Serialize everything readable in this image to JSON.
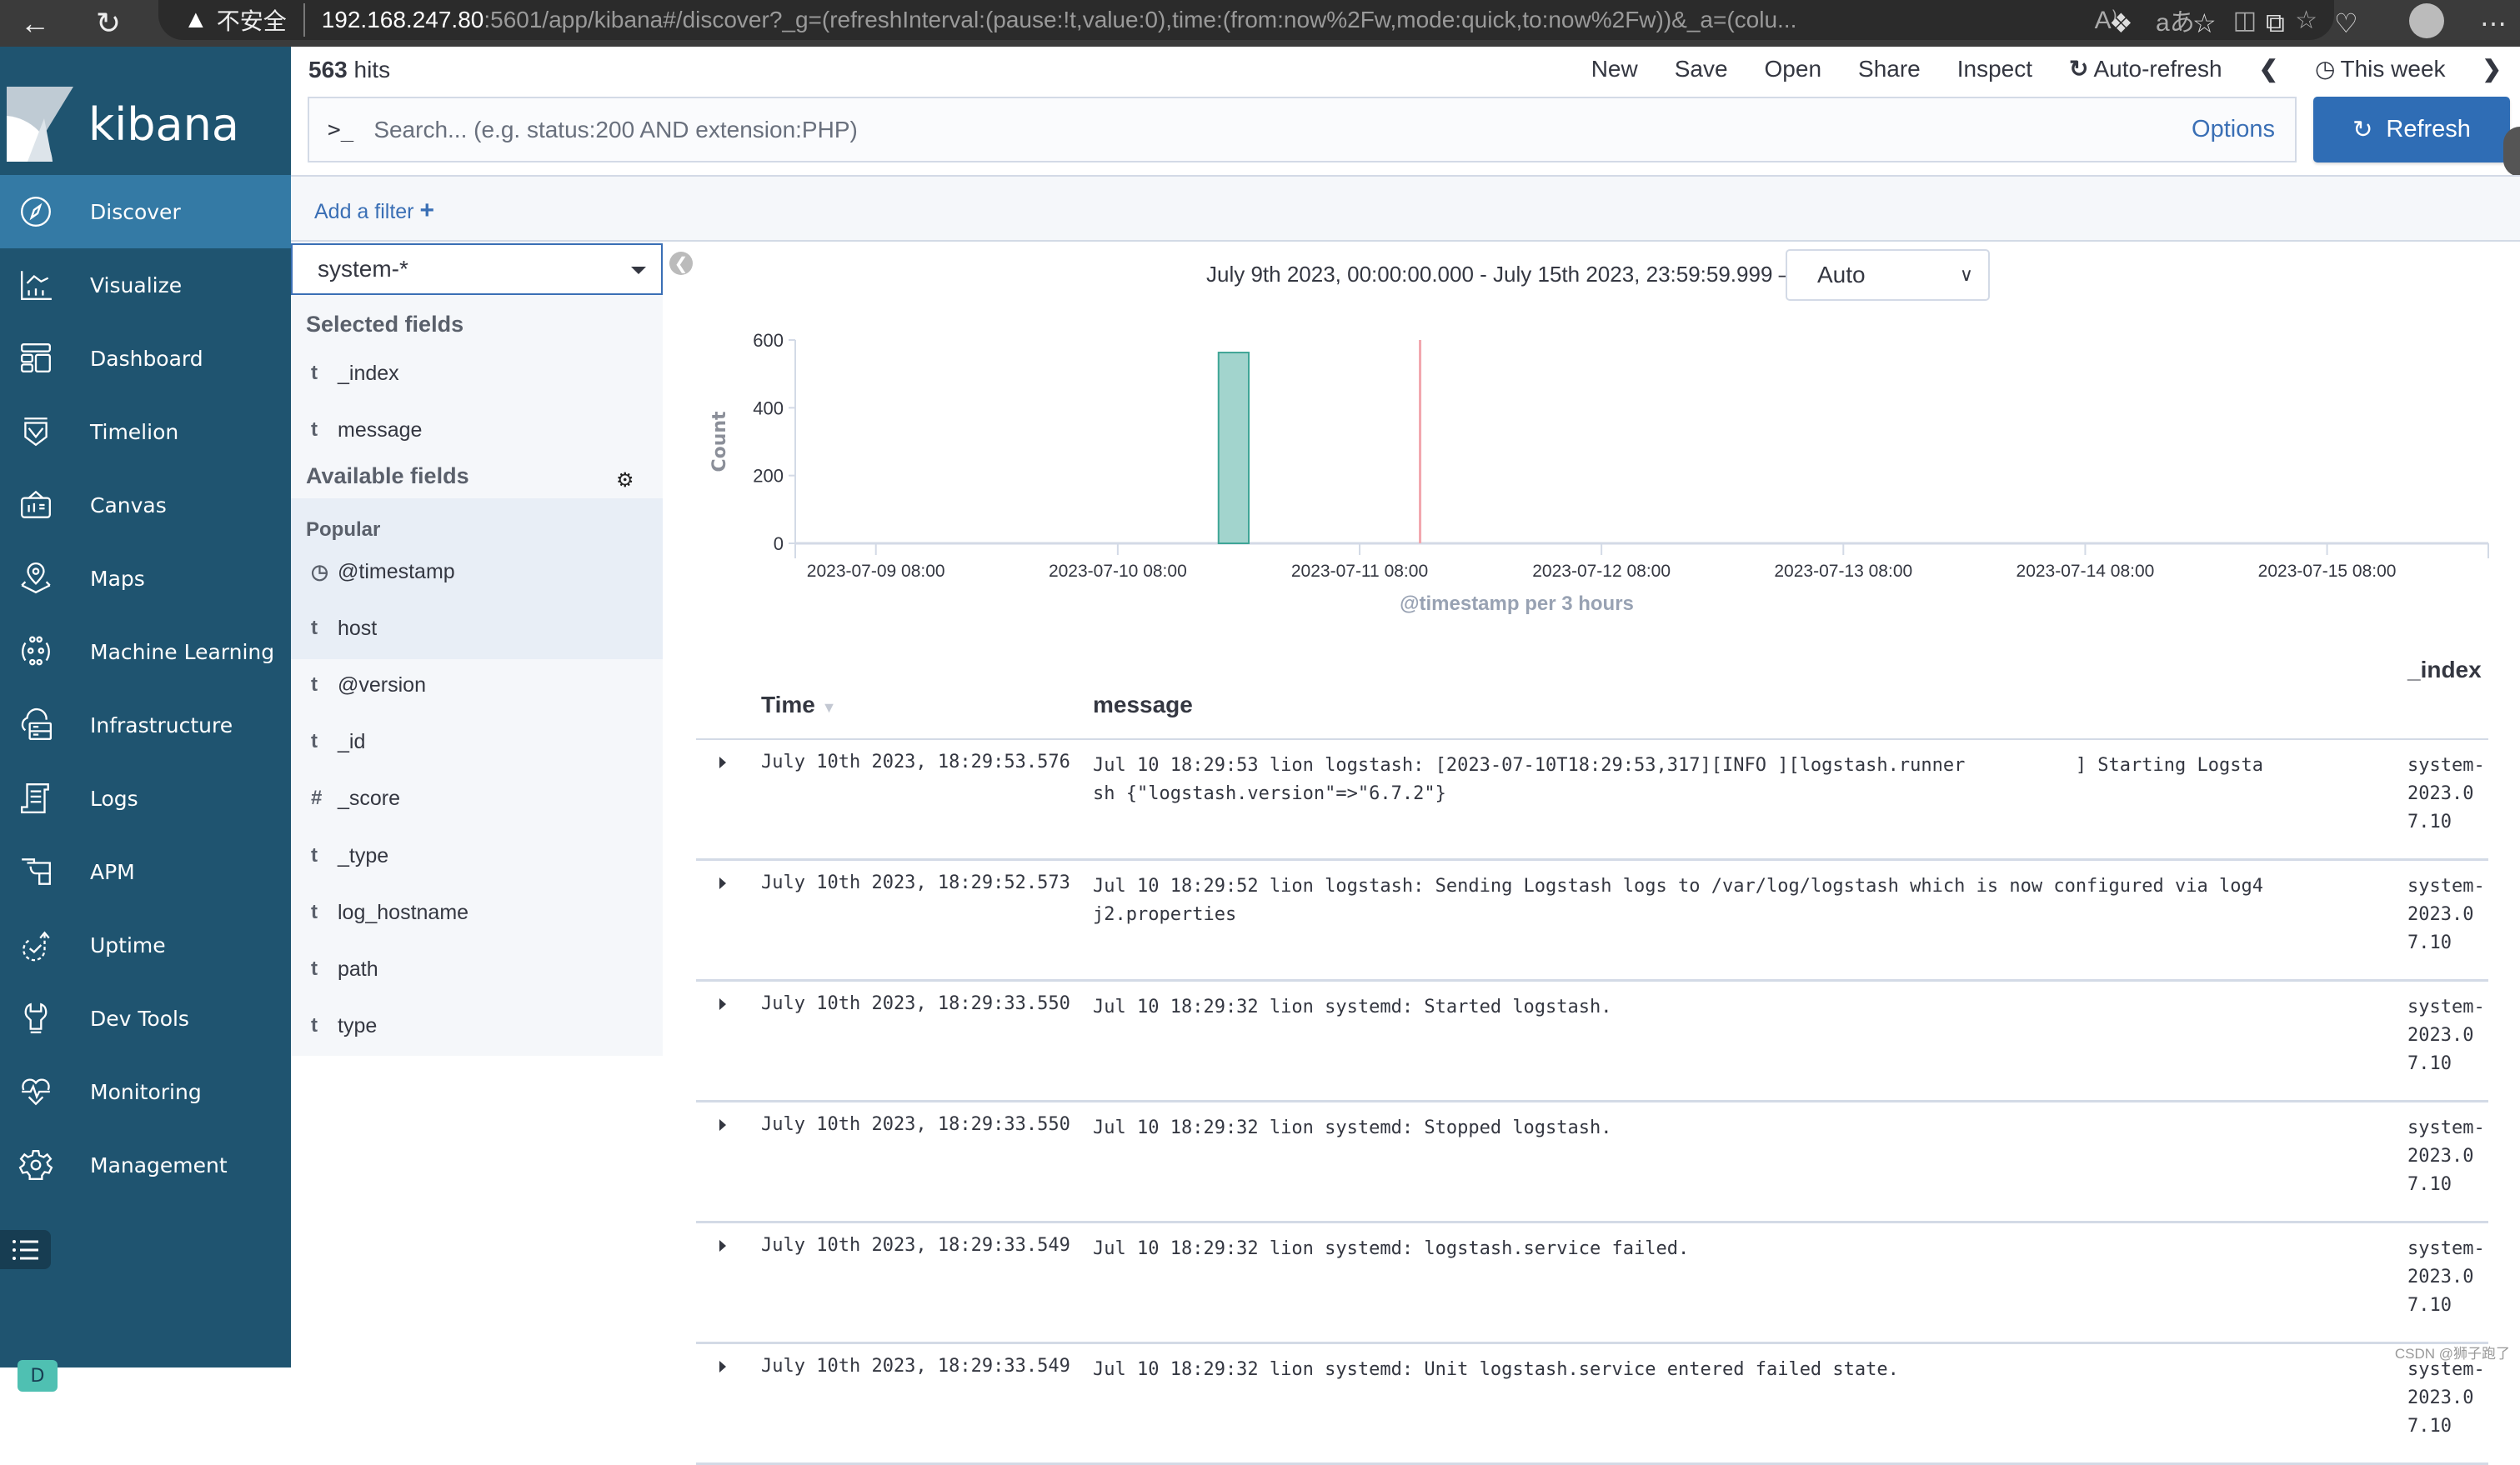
{
  "browser": {
    "warning_label": "不安全",
    "url_host": "192.168.247.80",
    "url_rest": ":5601/app/kibana#/discover?_g=(refreshInterval:(pause:!t,value:0),time:(from:now%2Fw,mode:quick,to:now%2Fw))&_a=(colu..."
  },
  "app": {
    "name": "kibana"
  },
  "sidebar": {
    "items": [
      {
        "label": "Discover",
        "icon": "compass-icon",
        "active": true
      },
      {
        "label": "Visualize",
        "icon": "visualize-icon"
      },
      {
        "label": "Dashboard",
        "icon": "dashboard-icon"
      },
      {
        "label": "Timelion",
        "icon": "timelion-icon"
      },
      {
        "label": "Canvas",
        "icon": "canvas-icon"
      },
      {
        "label": "Maps",
        "icon": "map-pin-icon"
      },
      {
        "label": "Machine Learning",
        "icon": "machine-learning-icon"
      },
      {
        "label": "Infrastructure",
        "icon": "cloud-server-icon"
      },
      {
        "label": "Logs",
        "icon": "logs-icon"
      },
      {
        "label": "APM",
        "icon": "apm-icon"
      },
      {
        "label": "Uptime",
        "icon": "uptime-icon"
      },
      {
        "label": "Dev Tools",
        "icon": "wrench-icon"
      },
      {
        "label": "Monitoring",
        "icon": "heartbeat-icon"
      },
      {
        "label": "Management",
        "icon": "gear-icon"
      }
    ],
    "space": {
      "badge": "D",
      "label": "Default"
    }
  },
  "header": {
    "hits_count": "563",
    "hits_label": " hits",
    "menu": {
      "new": "New",
      "save": "Save",
      "open": "Open",
      "share": "Share",
      "inspect": "Inspect",
      "auto_refresh": "Auto-refresh",
      "time_range": "This week"
    },
    "search_placeholder": "Search... (e.g. status:200 AND extension:PHP)",
    "search_value": "",
    "options_label": "Options",
    "refresh_label": "Refresh",
    "add_filter_label": "Add a filter"
  },
  "fields": {
    "index_pattern": "system-*",
    "selected_title": "Selected fields",
    "selected": [
      {
        "type": "t",
        "name": "_index"
      },
      {
        "type": "t",
        "name": "message"
      }
    ],
    "available_title": "Available fields",
    "popular_title": "Popular",
    "popular": [
      {
        "type": "clock",
        "name": "@timestamp"
      },
      {
        "type": "t",
        "name": "host"
      }
    ],
    "others": [
      {
        "type": "t",
        "name": "@version"
      },
      {
        "type": "t",
        "name": "_id"
      },
      {
        "type": "#",
        "name": "_score"
      },
      {
        "type": "t",
        "name": "_type"
      },
      {
        "type": "t",
        "name": "log_hostname"
      },
      {
        "type": "t",
        "name": "path"
      },
      {
        "type": "t",
        "name": "type"
      }
    ]
  },
  "histogram": {
    "range_label": "July 9th 2023, 00:00:00.000 - July 15th 2023, 23:59:59.999 —",
    "interval": "Auto"
  },
  "chart_data": {
    "type": "bar",
    "title": "",
    "xlabel": "@timestamp per 3 hours",
    "ylabel": "Count",
    "ylim": [
      0,
      600
    ],
    "yticks": [
      0,
      200,
      400,
      600
    ],
    "x_range_hours": [
      0,
      168
    ],
    "x_origin": "2023-07-09 00:00",
    "xticks": [
      {
        "label": "2023-07-09 08:00",
        "hour": 8
      },
      {
        "label": "2023-07-10 08:00",
        "hour": 32
      },
      {
        "label": "2023-07-11 08:00",
        "hour": 56
      },
      {
        "label": "2023-07-12 08:00",
        "hour": 80
      },
      {
        "label": "2023-07-13 08:00",
        "hour": 104
      },
      {
        "label": "2023-07-14 08:00",
        "hour": 128
      },
      {
        "label": "2023-07-15 08:00",
        "hour": 152
      }
    ],
    "bucket_hours": 3,
    "bars": [
      {
        "x": "2023-07-10 18:00",
        "start_hour": 42,
        "value": 563
      }
    ],
    "now_marker_hour": 62,
    "colors": {
      "bar_fill": "#a2d4cd",
      "bar_stroke": "#3fa596",
      "now_line": "#f2a7ae",
      "axis": "#d3dae6"
    },
    "grid": false,
    "legend": "none"
  },
  "table": {
    "columns": {
      "time": "Time",
      "message": "message",
      "index": "_index"
    },
    "rows": [
      {
        "time": "July 10th 2023, 18:29:53.576",
        "message": "Jul 10 18:29:53 lion logstash: [2023-07-10T18:29:53,317][INFO ][logstash.runner          ] Starting Logstash {\"logstash.version\"=>\"6.7.2\"}",
        "index": "system-2023.07.10"
      },
      {
        "time": "July 10th 2023, 18:29:52.573",
        "message": "Jul 10 18:29:52 lion logstash: Sending Logstash logs to /var/log/logstash which is now configured via log4j2.properties",
        "index": "system-2023.07.10"
      },
      {
        "time": "July 10th 2023, 18:29:33.550",
        "message": "Jul 10 18:29:32 lion systemd: Started logstash.",
        "index": "system-2023.07.10"
      },
      {
        "time": "July 10th 2023, 18:29:33.550",
        "message": "Jul 10 18:29:32 lion systemd: Stopped logstash.",
        "index": "system-2023.07.10"
      },
      {
        "time": "July 10th 2023, 18:29:33.549",
        "message": "Jul 10 18:29:32 lion systemd: logstash.service failed.",
        "index": "system-2023.07.10"
      },
      {
        "time": "July 10th 2023, 18:29:33.549",
        "message": "Jul 10 18:29:32 lion systemd: Unit logstash.service entered failed state.",
        "index": "system-2023.07.10"
      }
    ]
  },
  "watermark": "CSDN @狮子跑了"
}
